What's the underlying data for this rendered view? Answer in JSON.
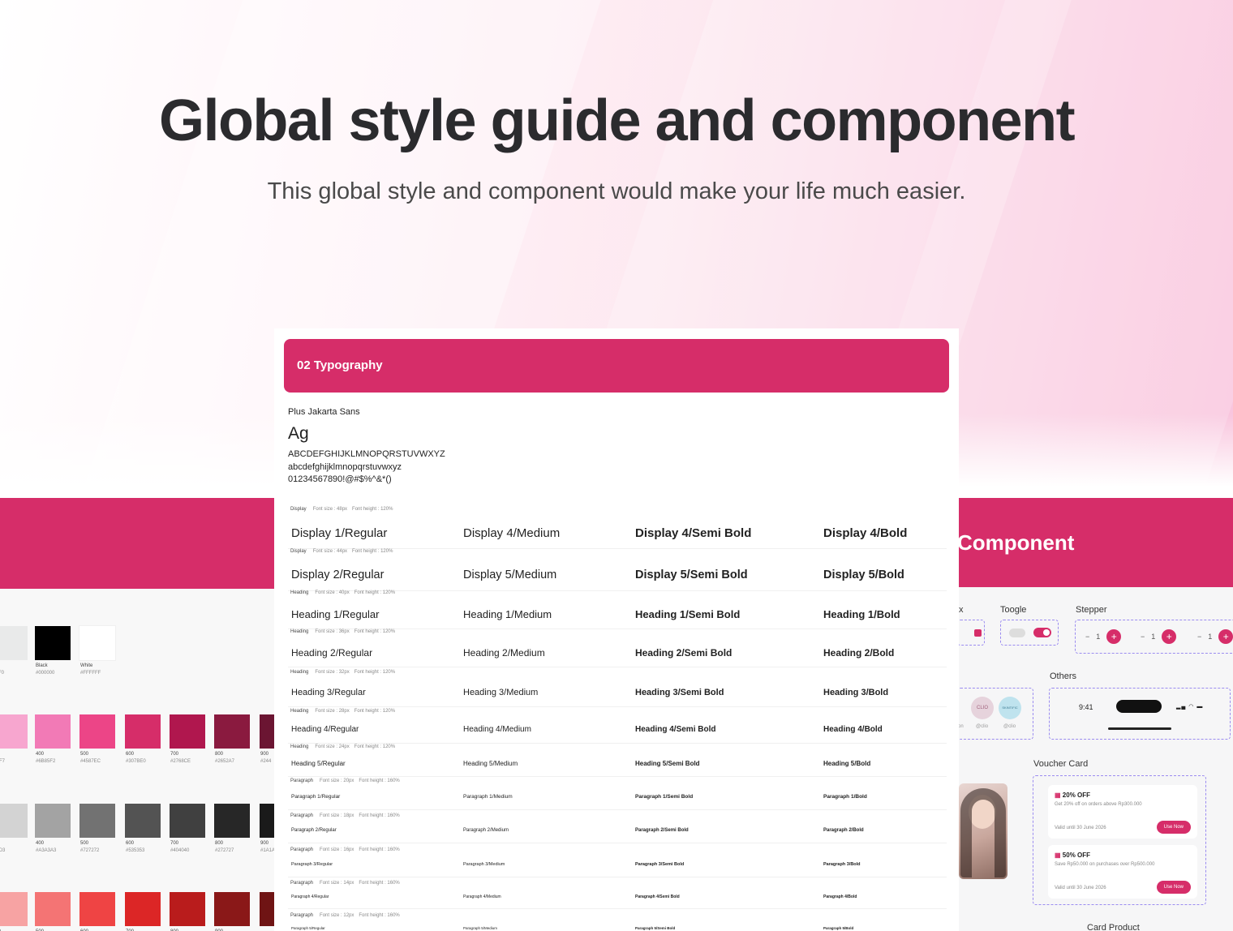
{
  "hero": {
    "title": "Global style guide and component",
    "subtitle": "This global style and component would make your life much easier."
  },
  "colors": {
    "brand": "#d62d69",
    "neutral_top": [
      {
        "name": "ent",
        "hex": "F0F0"
      },
      {
        "name": "Black",
        "hex": "#000000",
        "color": "#000000"
      },
      {
        "name": "White",
        "hex": "#FFFFFF",
        "color": "#FFFFFF"
      }
    ],
    "pink": [
      {
        "name": "",
        "hex": "CFF7",
        "color": "#f7a6cf"
      },
      {
        "name": "400",
        "hex": "#6B85F2",
        "color": "#f27ab6"
      },
      {
        "name": "500",
        "hex": "#4587EC",
        "color": "#ec4587"
      },
      {
        "name": "600",
        "hex": "#307BE0",
        "color": "#d62d69"
      },
      {
        "name": "700",
        "hex": "#2768CE",
        "color": "#b0174e"
      },
      {
        "name": "800",
        "hex": "#2652A7",
        "color": "#8a1a3f"
      },
      {
        "name": "900",
        "hex": "#244",
        "color": "#6b1532"
      }
    ],
    "gray": [
      {
        "name": "",
        "hex": "D3D3",
        "color": "#d3d3d3"
      },
      {
        "name": "400",
        "hex": "#A3A3A3",
        "color": "#a3a3a3"
      },
      {
        "name": "500",
        "hex": "#727272",
        "color": "#727272"
      },
      {
        "name": "600",
        "hex": "#535353",
        "color": "#535353"
      },
      {
        "name": "700",
        "hex": "#404040",
        "color": "#404040"
      },
      {
        "name": "800",
        "hex": "#272727",
        "color": "#272727"
      },
      {
        "name": "900",
        "hex": "#1A1A",
        "color": "#1a1a1a"
      }
    ],
    "red": [
      {
        "name": "400",
        "color": "#f7a3a3"
      },
      {
        "name": "500",
        "color": "#f47474"
      },
      {
        "name": "600",
        "color": "#ef4444"
      },
      {
        "name": "700",
        "color": "#dc2626"
      },
      {
        "name": "800",
        "color": "#b91c1c"
      },
      {
        "name": "900",
        "color": "#8a1818"
      },
      {
        "name": "",
        "color": "#6f1414"
      }
    ]
  },
  "component": {
    "title": "Component",
    "checkbox_label": "x",
    "toggle_label": "Toogle",
    "stepper_label": "Stepper",
    "stepper_value": "1",
    "others_label": "Others",
    "status_time": "9:41",
    "voucher_label": "Voucher Card",
    "card_product_label": "Card Product",
    "brands": [
      {
        "mark": "CLIO",
        "handle": "@clio",
        "color": "#e6d3dc"
      },
      {
        "mark": "SKINTIFIC",
        "handle": "@clio",
        "color": "#bfe3ee"
      }
    ],
    "avatar_caption": "on",
    "vouchers": [
      {
        "pct": "20% OFF",
        "desc": "Get 20% off on orders above Rp300.000",
        "valid": "Valid until 30 June 2026",
        "cta": "Use Now"
      },
      {
        "pct": "50% OFF",
        "desc": "Save Rp50.000 on purchases over Rp500.000",
        "valid": "Valid until 30 June 2026",
        "cta": "Use Now"
      }
    ]
  },
  "typography": {
    "section_title": "02 Typography",
    "font_name": "Plus Jakarta Sans",
    "ag": "Ag",
    "uppercase": "ABCDEFGHIJKLMNOPQRSTUVWXYZ",
    "lowercase": "abcdefghijklmnopqrstuvwxyz",
    "numbers": "01234567890!@#$%^&*()",
    "rows": [
      {
        "cat": "Display",
        "size": "Font size : 48px",
        "lh": "Font height : 120%",
        "cells": [
          "Display 1/Regular",
          "Display 4/Medium",
          "Display 4/Semi Bold",
          "Display 4/Bold"
        ]
      },
      {
        "cat": "Display",
        "size": "Font size : 44px",
        "lh": "Font height : 120%",
        "cells": [
          "Display 2/Regular",
          "Display 5/Medium",
          "Display 5/Semi Bold",
          "Display 5/Bold"
        ]
      },
      {
        "cat": "Heading",
        "size": "Font size : 40px",
        "lh": "Font height : 120%",
        "cells": [
          "Heading 1/Regular",
          "Heading 1/Medium",
          "Heading 1/Semi Bold",
          "Heading 1/Bold"
        ]
      },
      {
        "cat": "Heading",
        "size": "Font size : 36px",
        "lh": "Font height : 120%",
        "cells": [
          "Heading 2/Regular",
          "Heading 2/Medium",
          "Heading 2/Semi Bold",
          "Heading 2/Bold"
        ]
      },
      {
        "cat": "Heading",
        "size": "Font size : 32px",
        "lh": "Font height : 120%",
        "cells": [
          "Heading 3/Regular",
          "Heading 3/Medium",
          "Heading 3/Semi Bold",
          "Heading 3/Bold"
        ]
      },
      {
        "cat": "Heading",
        "size": "Font size : 28px",
        "lh": "Font height : 120%",
        "cells": [
          "Heading 4/Regular",
          "Heading 4/Medium",
          "Heading 4/Semi Bold",
          "Heading 4/Bold"
        ]
      },
      {
        "cat": "Heading",
        "size": "Font size : 24px",
        "lh": "Font height : 120%",
        "cells": [
          "Heading 5/Regular",
          "Heading 5/Medium",
          "Heading 5/Semi Bold",
          "Heading 5/Bold"
        ]
      },
      {
        "cat": "Paragraph",
        "size": "Font size : 20px",
        "lh": "Font height : 160%",
        "cells": [
          "Paragraph 1/Regular",
          "Paragraph 1/Medium",
          "Paragraph 1/Semi Bold",
          "Paragraph 1/Bold"
        ]
      },
      {
        "cat": "Paragraph",
        "size": "Font size : 18px",
        "lh": "Font height : 160%",
        "cells": [
          "Paragraph 2/Regular",
          "Paragraph 2/Medium",
          "Paragraph 2/Semi Bold",
          "Paragraph 2/Bold"
        ]
      },
      {
        "cat": "Paragraph",
        "size": "Font size : 16px",
        "lh": "Font height : 160%",
        "cells": [
          "Paragraph 3/Regular",
          "Paragraph 3/Medium",
          "Paragraph 3/Semi Bold",
          "Paragraph 3/Bold"
        ]
      },
      {
        "cat": "Paragraph",
        "size": "Font size : 14px",
        "lh": "Font height : 160%",
        "cells": [
          "Paragraph 4/Regular",
          "Paragraph 4/Medium",
          "Paragraph 4/Semi Bold",
          "Paragraph 4/Bold"
        ]
      },
      {
        "cat": "Paragraph",
        "size": "Font size : 12px",
        "lh": "Font height : 160%",
        "cells": [
          "Paragraph 5/Regular",
          "Paragraph 5/Medium",
          "Paragraph 5/Semi Bold",
          "Paragraph 5/Bold"
        ]
      }
    ]
  }
}
